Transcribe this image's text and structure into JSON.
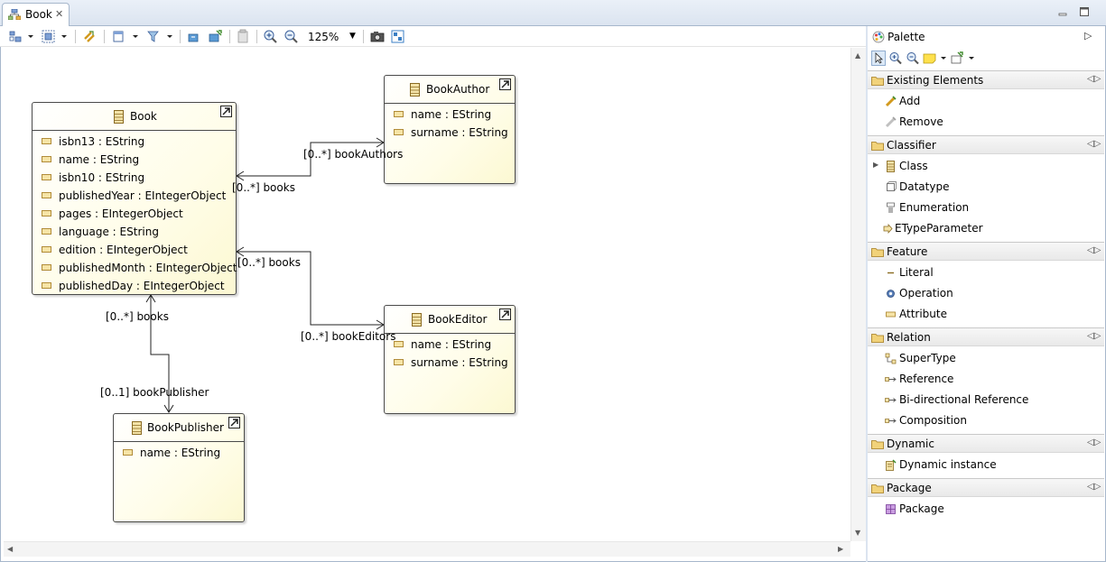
{
  "editor": {
    "tab_title": "Book",
    "tab_close": "✕",
    "zoom_level": "125%"
  },
  "diagram": {
    "classes": {
      "book": {
        "name": "Book",
        "attributes": [
          "isbn13 : EString",
          "name : EString",
          "isbn10 : EString",
          "publishedYear : EIntegerObject",
          "pages : EIntegerObject",
          "language : EString",
          "edition : EIntegerObject",
          "publishedMonth : EIntegerObject",
          "publishedDay : EIntegerObject"
        ]
      },
      "book_author": {
        "name": "BookAuthor",
        "attributes": [
          "name : EString",
          "surname : EString"
        ]
      },
      "book_editor": {
        "name": "BookEditor",
        "attributes": [
          "name : EString",
          "surname : EString"
        ]
      },
      "book_publisher": {
        "name": "BookPublisher",
        "attributes": [
          "name : EString"
        ]
      }
    },
    "edge_labels": {
      "book_authors": "[0..*] bookAuthors",
      "author_books": "[0..*] books",
      "editor_books": "[0..*] books",
      "book_editors": "[0..*] bookEditors",
      "publisher_books": "[0..*] books",
      "book_publisher": "[0..1] bookPublisher"
    }
  },
  "palette": {
    "title": "Palette",
    "drawers": [
      {
        "label": "Existing Elements",
        "entries": [
          {
            "label": "Add",
            "icon": "add-icon"
          },
          {
            "label": "Remove",
            "icon": "remove-icon"
          }
        ]
      },
      {
        "label": "Classifier",
        "entries": [
          {
            "label": "Class",
            "icon": "class-icon"
          },
          {
            "label": "Datatype",
            "icon": "datatype-icon"
          },
          {
            "label": "Enumeration",
            "icon": "enumeration-icon"
          },
          {
            "label": "ETypeParameter",
            "icon": "type-parameter-icon"
          }
        ]
      },
      {
        "label": "Feature",
        "entries": [
          {
            "label": "Literal",
            "icon": "literal-icon"
          },
          {
            "label": "Operation",
            "icon": "operation-icon"
          },
          {
            "label": "Attribute",
            "icon": "attribute-icon"
          }
        ]
      },
      {
        "label": "Relation",
        "entries": [
          {
            "label": "SuperType",
            "icon": "supertype-icon"
          },
          {
            "label": "Reference",
            "icon": "reference-icon"
          },
          {
            "label": "Bi-directional Reference",
            "icon": "bidirectional-reference-icon"
          },
          {
            "label": "Composition",
            "icon": "composition-icon"
          }
        ]
      },
      {
        "label": "Dynamic",
        "entries": [
          {
            "label": "Dynamic instance",
            "icon": "dynamic-instance-icon"
          }
        ]
      },
      {
        "label": "Package",
        "entries": [
          {
            "label": "Package",
            "icon": "package-icon"
          }
        ]
      }
    ]
  },
  "colors": {
    "class_fill": "#fffde8",
    "class_border": "#4a4a4a",
    "attribute_icon": "#f6e4a6",
    "frame_border": "#a7b7cc"
  }
}
